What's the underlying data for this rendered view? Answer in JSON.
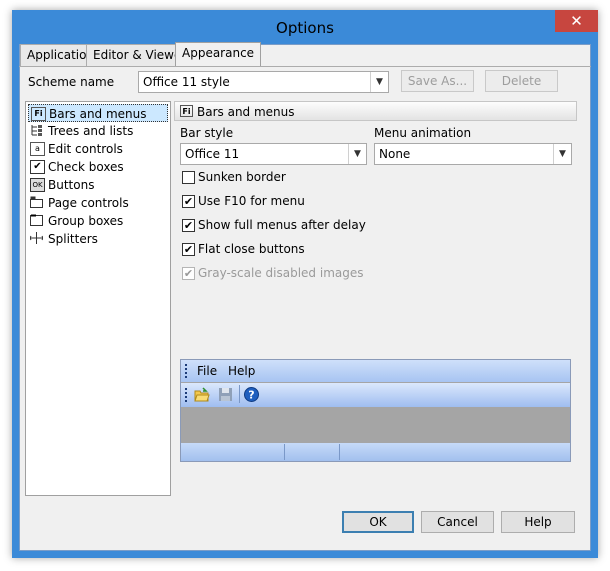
{
  "window": {
    "title": "Options",
    "close_glyph": "✕"
  },
  "tabs": [
    {
      "label": "Application"
    },
    {
      "label": "Editor & Viewers"
    },
    {
      "label": "Appearance"
    }
  ],
  "scheme": {
    "label": "Scheme name",
    "value": "Office 11 style",
    "save_label": "Save As...",
    "delete_label": "Delete"
  },
  "sidebar": {
    "items": [
      {
        "label": "Bars and menus",
        "icon": "bars-menus-icon"
      },
      {
        "label": "Trees and lists",
        "icon": "tree-icon"
      },
      {
        "label": "Edit controls",
        "icon": "edit-control-icon"
      },
      {
        "label": "Check boxes",
        "icon": "checkbox-icon"
      },
      {
        "label": "Buttons",
        "icon": "button-icon"
      },
      {
        "label": "Page controls",
        "icon": "page-control-icon"
      },
      {
        "label": "Group boxes",
        "icon": "group-box-icon"
      },
      {
        "label": "Splitters",
        "icon": "splitter-icon"
      }
    ]
  },
  "panel": {
    "header": "Bars and menus",
    "bar_style_label": "Bar style",
    "bar_style_value": "Office 11",
    "menu_animation_label": "Menu animation",
    "menu_animation_value": "None",
    "options": [
      {
        "label": "Sunken border",
        "checked": false,
        "enabled": true
      },
      {
        "label": "Use F10 for menu",
        "checked": true,
        "enabled": true
      },
      {
        "label": "Show full menus after delay",
        "checked": true,
        "enabled": true
      },
      {
        "label": "Flat close buttons",
        "checked": true,
        "enabled": true
      },
      {
        "label": "Gray-scale disabled images",
        "checked": true,
        "enabled": false
      }
    ]
  },
  "preview": {
    "menu_file": "File",
    "menu_help": "Help"
  },
  "footer": {
    "ok_label": "OK",
    "cancel_label": "Cancel",
    "help_label": "Help"
  },
  "colors": {
    "title_bar": "#3b8ad8",
    "close_button": "#c7463f",
    "selection": "#cce8ff",
    "preview_bar": "#a7c4f2"
  }
}
